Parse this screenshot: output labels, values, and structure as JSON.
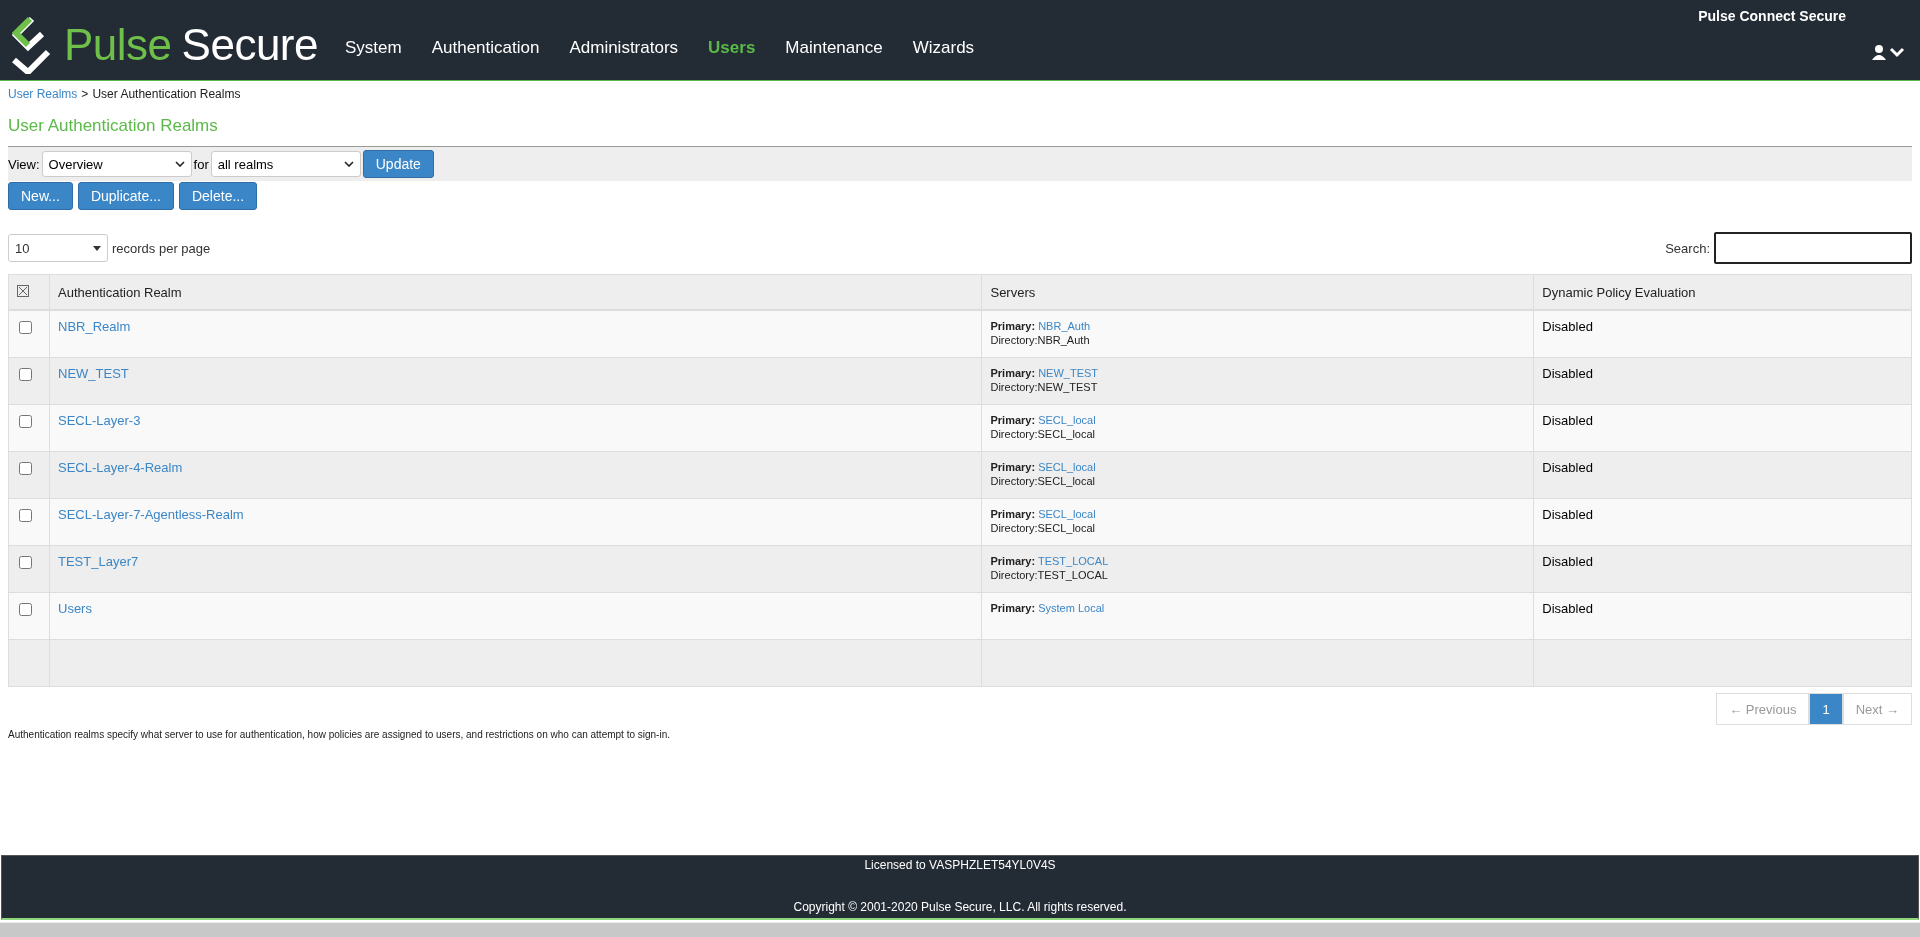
{
  "header": {
    "brand_first": "Pulse",
    "brand_second": "Secure",
    "product": "Pulse Connect Secure",
    "nav": [
      {
        "label": "System",
        "selected": false
      },
      {
        "label": "Authentication",
        "selected": false
      },
      {
        "label": "Administrators",
        "selected": false
      },
      {
        "label": "Users",
        "selected": true
      },
      {
        "label": "Maintenance",
        "selected": false
      },
      {
        "label": "Wizards",
        "selected": false
      }
    ]
  },
  "breadcrumb": {
    "link": "User Realms",
    "separator": ">",
    "current": "User Authentication Realms"
  },
  "title": "User Authentication Realms",
  "filter": {
    "view_label": "View:",
    "view_value": "Overview",
    "for_label": "for",
    "for_value": "all realms",
    "update": "Update"
  },
  "actions": [
    "New...",
    "Duplicate...",
    "Delete..."
  ],
  "paging": {
    "page_size": "10",
    "page_size_label": "records per page",
    "search_label": "Search:"
  },
  "table": {
    "columns": [
      "Authentication Realm",
      "Servers",
      "Dynamic Policy Evaluation"
    ],
    "rows": [
      {
        "checked": false,
        "realm": "NBR_Realm",
        "primary_label": "Primary:",
        "primary": "NBR_Auth",
        "directory": "Directory:NBR_Auth",
        "dynamic": "Disabled"
      },
      {
        "checked": false,
        "realm": "NEW_TEST",
        "primary_label": "Primary:",
        "primary": "NEW_TEST",
        "directory": "Directory:NEW_TEST",
        "dynamic": "Disabled"
      },
      {
        "checked": false,
        "realm": "SECL-Layer-3",
        "primary_label": "Primary:",
        "primary": "SECL_local",
        "directory": "Directory:SECL_local",
        "dynamic": "Disabled"
      },
      {
        "checked": false,
        "realm": "SECL-Layer-4-Realm",
        "primary_label": "Primary:",
        "primary": "SECL_local",
        "directory": "Directory:SECL_local",
        "dynamic": "Disabled"
      },
      {
        "checked": false,
        "realm": "SECL-Layer-7-Agentless-Realm",
        "primary_label": "Primary:",
        "primary": "SECL_local",
        "directory": "Directory:SECL_local",
        "dynamic": "Disabled"
      },
      {
        "checked": false,
        "realm": "TEST_Layer7",
        "primary_label": "Primary:",
        "primary": "TEST_LOCAL",
        "directory": "Directory:TEST_LOCAL",
        "dynamic": "Disabled"
      },
      {
        "checked": false,
        "realm": "Users",
        "primary_label": "Primary:",
        "primary": "System Local",
        "dynamic": "Disabled"
      }
    ]
  },
  "pagination": {
    "previous": "← Previous",
    "pages": [
      {
        "label": "1",
        "selected": true
      }
    ],
    "next": "Next →"
  },
  "description": "Authentication realms specify what server to use for authentication, how policies are assigned to users, and restrictions on who can attempt to sign-in.",
  "footer": {
    "license": "Licensed to VASPHZLET54YL0V4S",
    "copyright": "Copyright © 2001-2020 Pulse Secure, LLC. All rights reserved."
  }
}
